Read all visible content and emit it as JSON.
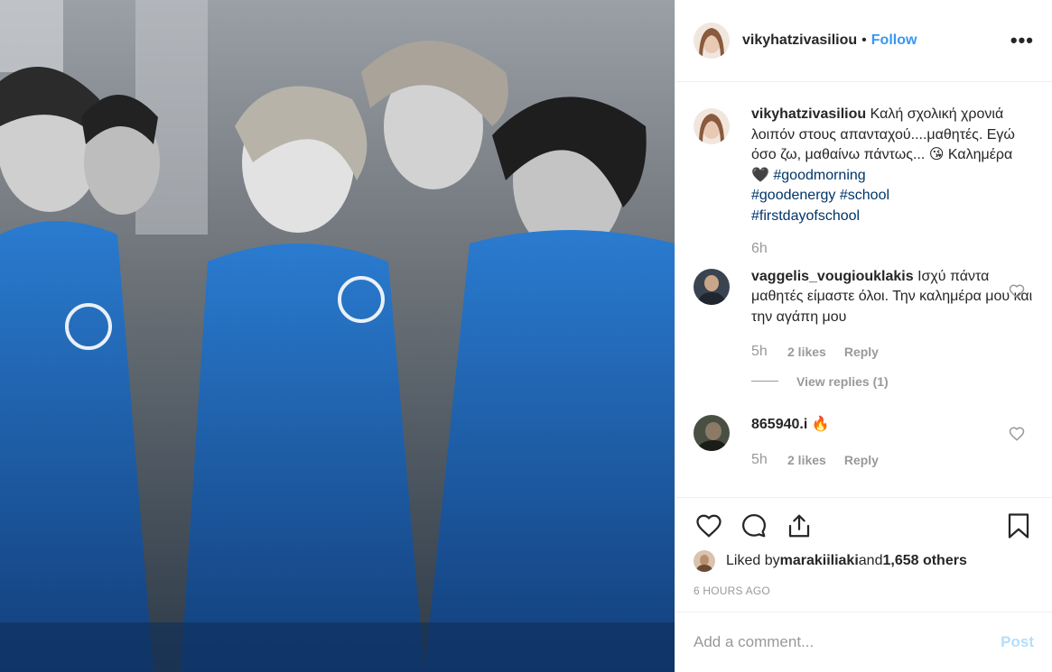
{
  "post": {
    "username": "vikyhatzivasiliou",
    "dot": "•",
    "follow_label": "Follow",
    "more_label": "•••",
    "caption_part1": "Καλή σχολική χρονιά λοιπόν στους απανταχού....μαθητές. Εγώ όσο ζω, μαθαίνω πάντως... 😘 Καλημέρα 🖤 ",
    "tag1": "#goodmorning",
    "tag2": "#goodenergy",
    "tag3": "#school",
    "tag4": "#firstdayofschool",
    "caption_time": "6h"
  },
  "comments": [
    {
      "username": "vaggelis_vougiouklakis",
      "text": "Ισχύ πάντα μαθητές είμαστε όλοι. Την καλημέρα μου και την αγάπη μου",
      "time": "5h",
      "likes": "2 likes",
      "reply": "Reply",
      "view_replies": "View replies (1)"
    },
    {
      "username": "865940.i",
      "text": "🔥",
      "time": "5h",
      "likes": "2 likes",
      "reply": "Reply"
    }
  ],
  "liked_by": {
    "prefix": "Liked by ",
    "user": "marakiiliaki",
    "mid": " and ",
    "others": "1,658 others"
  },
  "time_ago": "6 HOURS AGO",
  "add_comment": {
    "placeholder": "Add a comment...",
    "post_label": "Post"
  },
  "colors": {
    "accent": "#3897f0",
    "hashtag": "#003569",
    "post_disabled": "#b2dffc",
    "photo_blue": "#1f5fa8"
  }
}
